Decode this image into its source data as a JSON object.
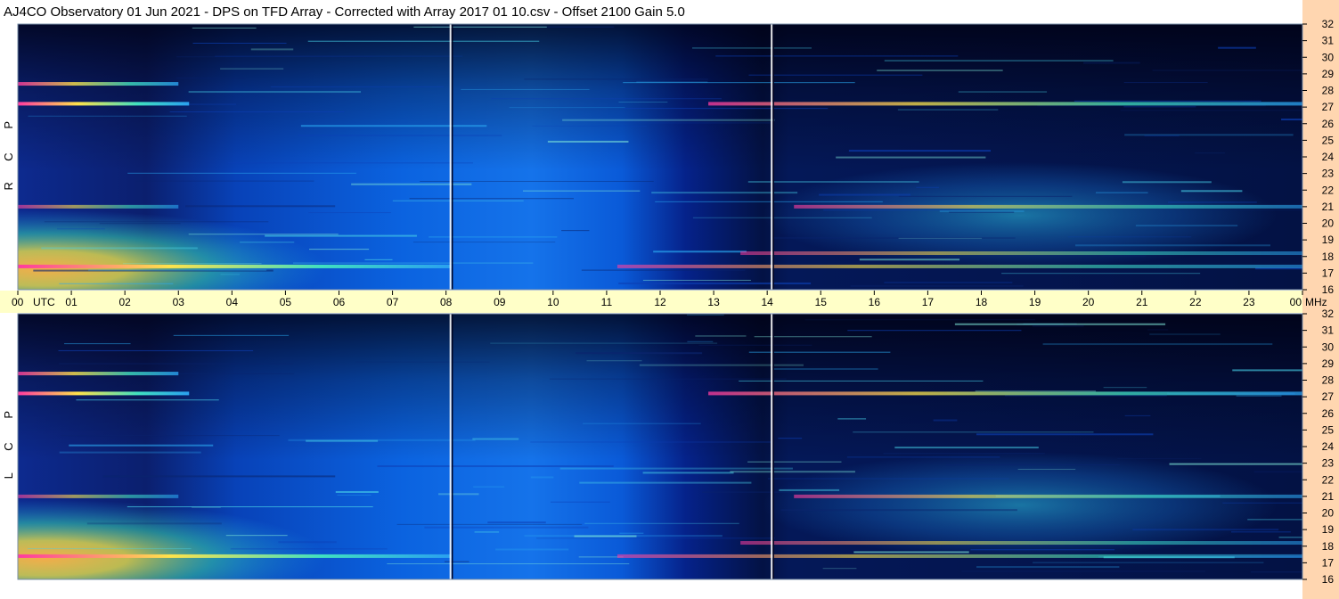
{
  "title": "AJ4CO Observatory  01 Jun 2021  -  DPS on TFD Array  -  Corrected with Array 2017 01 10.csv  -  Offset 2100  Gain 5.0",
  "colors": {
    "background": "#ffffff",
    "band": "#ffffc8",
    "right_strip": "#ffd6b0",
    "frame": "#7a8fa8",
    "deep": "#02031f",
    "mid": "#0a57d8",
    "light": "#1fa9f0"
  },
  "chart_data": {
    "type": "heatmap",
    "title": "AJ4CO Observatory  01 Jun 2021  -  DPS on TFD Array  -  Corrected with Array 2017 01 10.csv  -  Offset 2100  Gain 5.0",
    "x_unit_label": "UTC",
    "y_unit_label": "MHz",
    "x_ticks": [
      "00",
      "01",
      "02",
      "03",
      "04",
      "05",
      "06",
      "07",
      "08",
      "09",
      "10",
      "11",
      "12",
      "13",
      "14",
      "15",
      "16",
      "17",
      "18",
      "19",
      "20",
      "21",
      "22",
      "23",
      "00"
    ],
    "xlim": [
      0,
      24
    ],
    "ylim": [
      16,
      32
    ],
    "y_ticks": [
      32,
      31,
      30,
      29,
      28,
      27,
      26,
      25,
      24,
      23,
      22,
      21,
      20,
      19,
      18,
      17,
      16
    ],
    "panels": [
      {
        "name": "R C P",
        "letters": [
          "P",
          "C",
          "R"
        ]
      },
      {
        "name": "L C P",
        "letters": [
          "P",
          "C",
          "L"
        ]
      }
    ],
    "vertical_markers_utc": [
      8.1,
      14.1
    ],
    "hot_bands_mhz": [
      {
        "mhz": 27.2,
        "hours": [
          0,
          3.2
        ],
        "level": 1.0
      },
      {
        "mhz": 27.2,
        "hours": [
          12.9,
          24
        ],
        "level": 0.75
      },
      {
        "mhz": 28.4,
        "hours": [
          0,
          3.0
        ],
        "level": 0.8
      },
      {
        "mhz": 17.4,
        "hours": [
          0,
          8.1
        ],
        "level": 1.0
      },
      {
        "mhz": 17.4,
        "hours": [
          11.2,
          24
        ],
        "level": 0.6
      },
      {
        "mhz": 18.2,
        "hours": [
          13.5,
          24
        ],
        "level": 0.55
      },
      {
        "mhz": 21.0,
        "hours": [
          0,
          3.0
        ],
        "level": 0.6
      },
      {
        "mhz": 21.0,
        "hours": [
          14.5,
          24
        ],
        "level": 0.6
      }
    ]
  }
}
